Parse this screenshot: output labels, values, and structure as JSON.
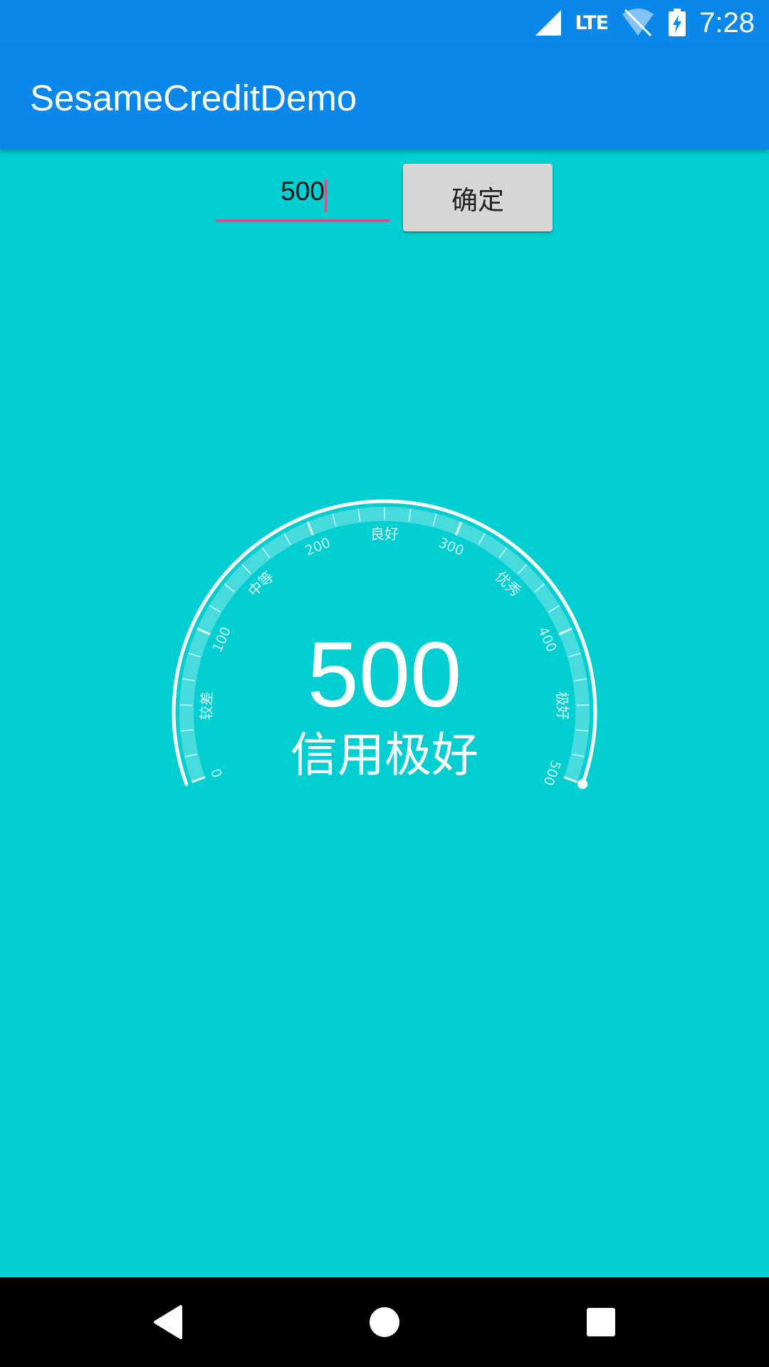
{
  "status_bar": {
    "network_label": "LTE",
    "time": "7:28",
    "icons": [
      "signal-icon",
      "wifi-off-icon",
      "battery-charging-icon"
    ]
  },
  "app_bar": {
    "title": "SesameCreditDemo",
    "color": "#0A87EA"
  },
  "form": {
    "score_value": "500",
    "confirm_label": "确定",
    "accent_color": "#D94D8A"
  },
  "gauge": {
    "value": "500",
    "status": "信用极好",
    "min": 0,
    "max": 500,
    "current": 500,
    "number_labels": [
      "0",
      "100",
      "200",
      "300",
      "400",
      "500"
    ],
    "category_labels": [
      "较差",
      "中等",
      "良好",
      "优秀",
      "极好"
    ],
    "background_color": "#00CED1"
  },
  "navigation": {
    "back": "back-icon",
    "home": "home-icon",
    "recents": "recents-icon"
  }
}
